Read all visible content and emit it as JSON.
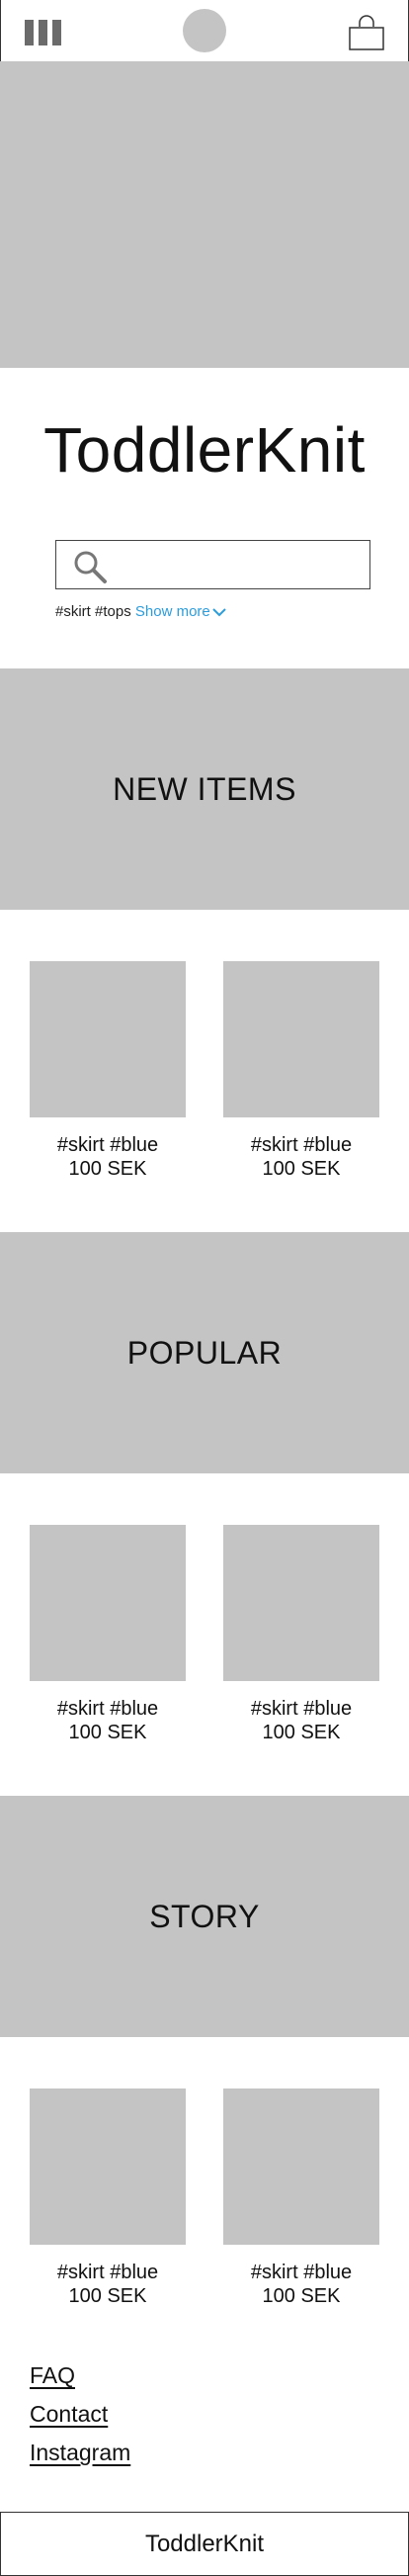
{
  "header": {
    "menu_icon": "menu-icon",
    "logo_icon": "logo-placeholder-circle",
    "bag_icon": "shopping-bag-icon"
  },
  "brand": {
    "title": "ToddlerKnit"
  },
  "search": {
    "placeholder": "",
    "value": "",
    "icon": "search-icon",
    "tags": [
      "#skirt",
      "#tops"
    ],
    "show_more_label": "Show more",
    "accent_color": "#2d9cdb"
  },
  "sections": [
    {
      "title": "NEW ITEMS",
      "products": [
        {
          "tags": "#skirt #blue",
          "price": "100 SEK"
        },
        {
          "tags": "#skirt #blue",
          "price": "100 SEK"
        }
      ]
    },
    {
      "title": "POPULAR",
      "products": [
        {
          "tags": "#skirt #blue",
          "price": "100 SEK"
        },
        {
          "tags": "#skirt #blue",
          "price": "100 SEK"
        }
      ]
    },
    {
      "title": "STORY",
      "products": [
        {
          "tags": "#skirt #blue",
          "price": "100 SEK"
        },
        {
          "tags": "#skirt #blue",
          "price": "100 SEK"
        }
      ]
    }
  ],
  "footer": {
    "links": [
      "FAQ",
      "Contact",
      "Instagram"
    ],
    "brand": "ToddlerKnit"
  },
  "colors": {
    "placeholder_gray": "#c4c4c4",
    "icon_gray": "#6b6b6b"
  }
}
